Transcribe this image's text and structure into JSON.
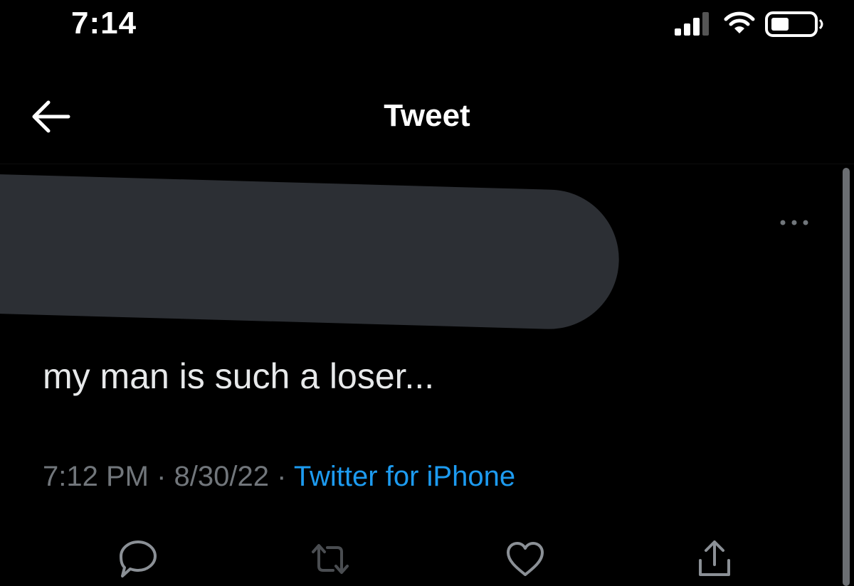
{
  "status_bar": {
    "time": "7:14"
  },
  "header": {
    "title": "Tweet"
  },
  "tweet": {
    "text": "my man is such a loser...",
    "time": "7:12 PM",
    "separator": " · ",
    "date": "8/30/22",
    "source": "Twitter for iPhone"
  },
  "icons": {
    "back": "arrow-left-icon",
    "more": "more-horizontal-icon",
    "reply": "reply-icon",
    "retweet": "retweet-icon",
    "like": "heart-icon",
    "share": "share-icon"
  },
  "colors": {
    "background": "#000000",
    "text": "#e7e9ea",
    "muted": "#71767b",
    "link": "#1d9bf0",
    "redaction": "#2c2f34"
  }
}
